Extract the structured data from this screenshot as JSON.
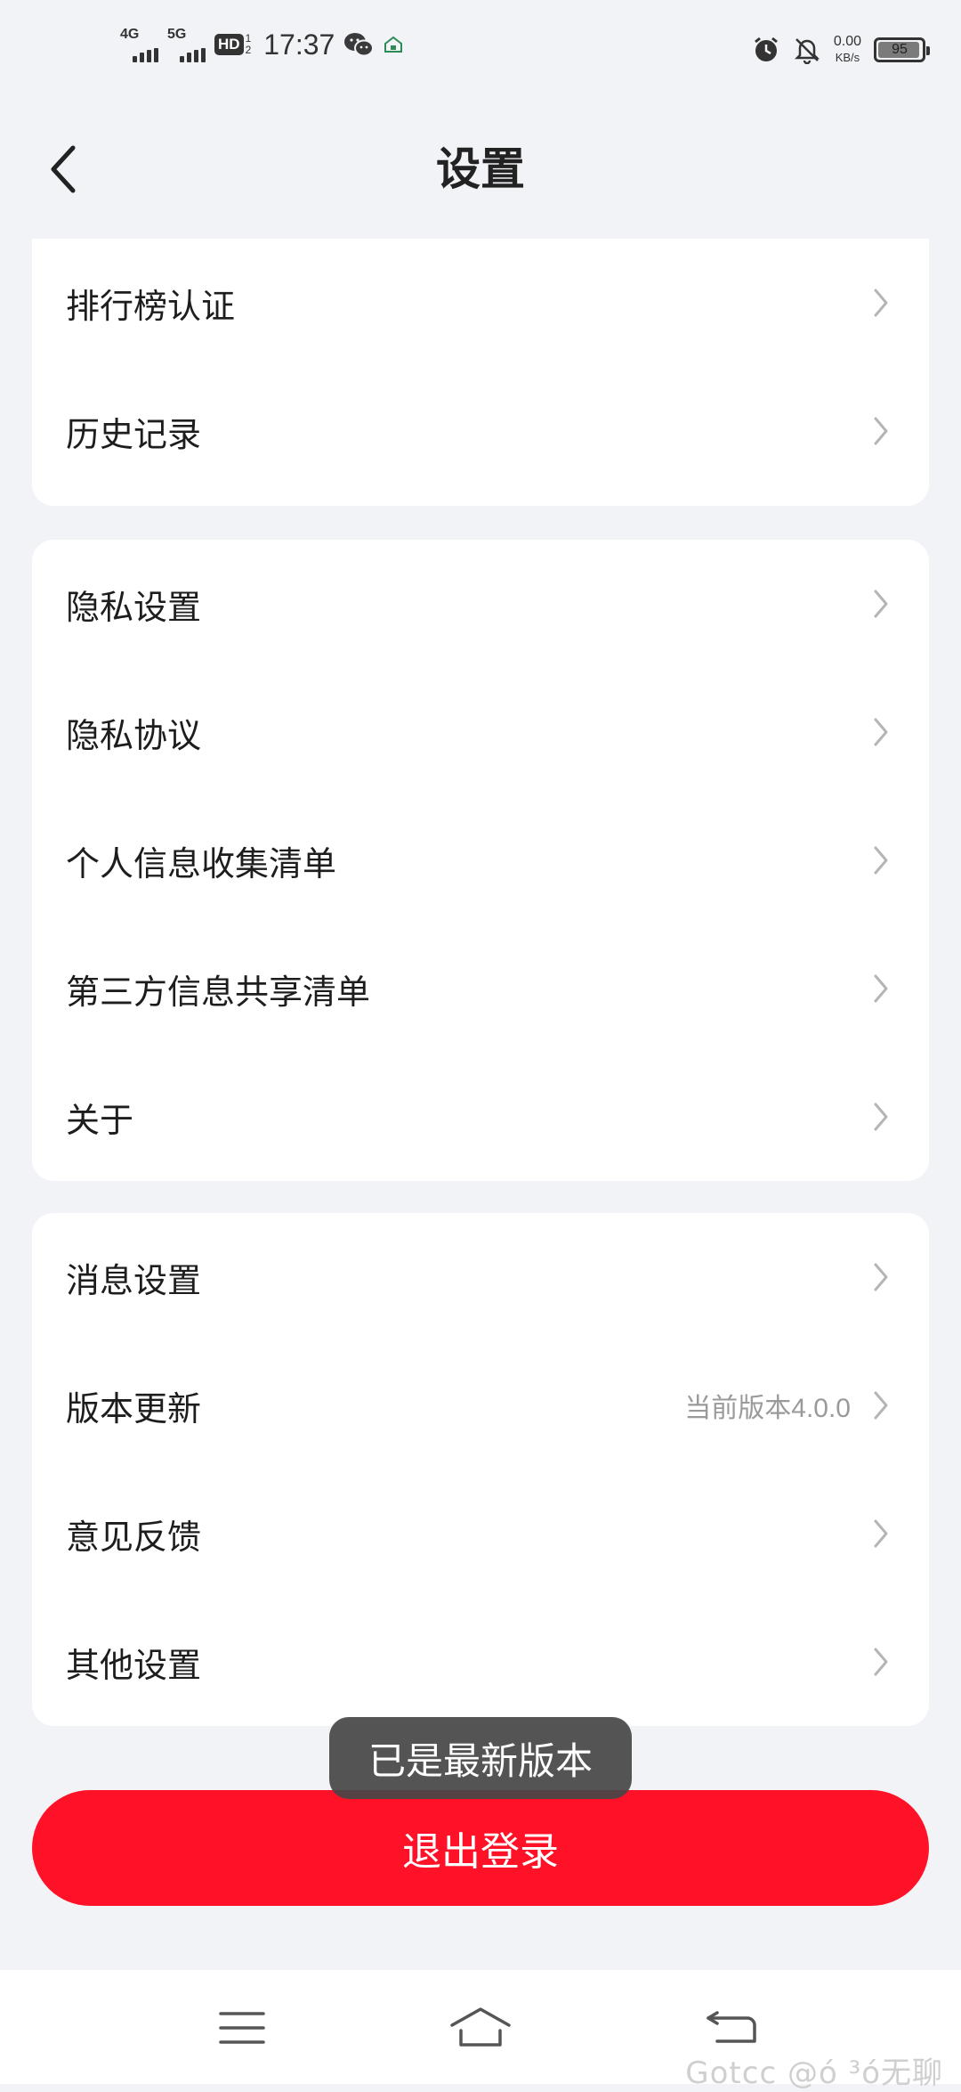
{
  "status_bar": {
    "sim1_label": "4G",
    "sim2_label": "5G",
    "hd_label": "HD",
    "hd_sub_top": "1",
    "hd_sub_bottom": "2",
    "time": "17:37",
    "net_speed_value": "0.00",
    "net_speed_unit": "KB/s",
    "battery_level": 95,
    "battery_text": "95"
  },
  "header": {
    "title": "设置"
  },
  "groups": [
    {
      "items": [
        {
          "label": "排行榜认证"
        },
        {
          "label": "历史记录"
        }
      ]
    },
    {
      "items": [
        {
          "label": "隐私设置"
        },
        {
          "label": "隐私协议"
        },
        {
          "label": "个人信息收集清单"
        },
        {
          "label": "第三方信息共享清单"
        },
        {
          "label": "关于"
        }
      ]
    },
    {
      "items": [
        {
          "label": "消息设置"
        },
        {
          "label": "版本更新",
          "value": "当前版本4.0.0"
        },
        {
          "label": "意见反馈"
        },
        {
          "label": "其他设置"
        }
      ]
    }
  ],
  "toast": "已是最新版本",
  "logout_label": "退出登录",
  "watermark": "Gotcc @ó ³ó无聊",
  "colors": {
    "background": "#f1f3f7",
    "accent": "#ff1128",
    "card": "#ffffff"
  },
  "icons": {
    "back": "chevron-left-icon",
    "row_arrow": "chevron-right-icon",
    "nav_menu": "menu-icon",
    "nav_home": "home-icon",
    "nav_back": "back-icon"
  }
}
